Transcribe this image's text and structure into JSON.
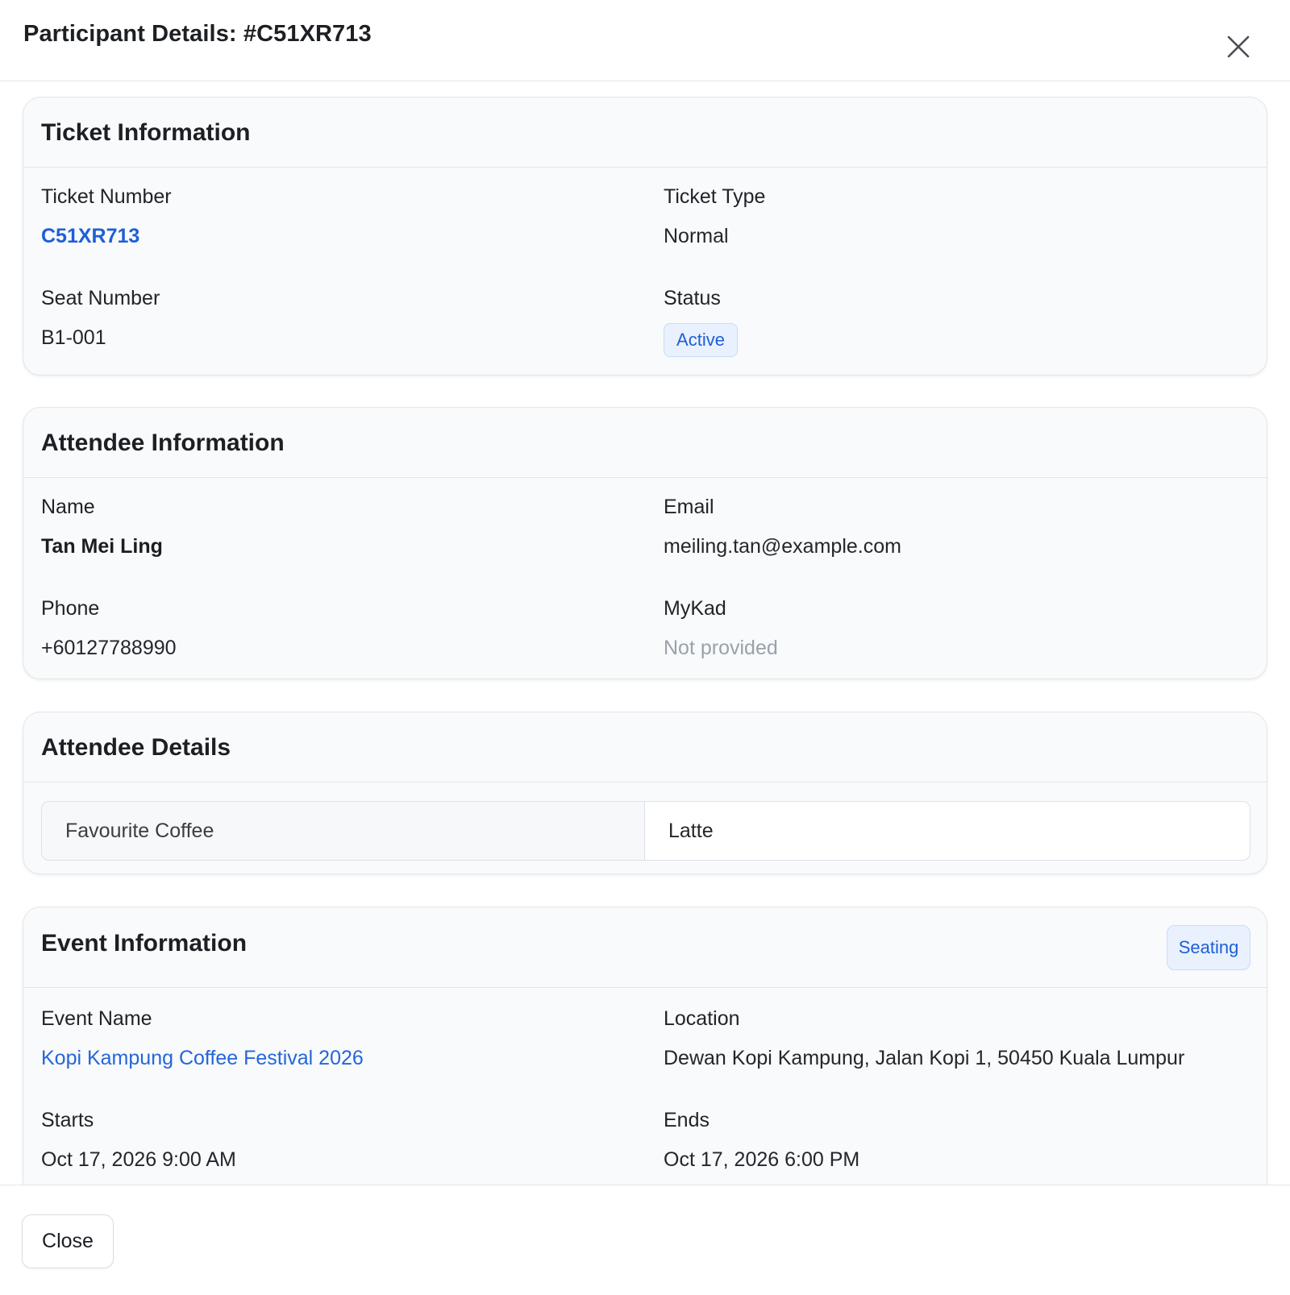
{
  "modal": {
    "title": "Participant Details: #C51XR713",
    "close_icon": "close-icon"
  },
  "ticket_info": {
    "title": "Ticket Information",
    "ticket_number_label": "Ticket Number",
    "ticket_number": "C51XR713",
    "ticket_type_label": "Ticket Type",
    "ticket_type": "Normal",
    "seat_number_label": "Seat Number",
    "seat_number": "B1-001",
    "status_label": "Status",
    "status": "Active"
  },
  "attendee_info": {
    "title": "Attendee Information",
    "name_label": "Name",
    "name": "Tan Mei Ling",
    "email_label": "Email",
    "email": "meiling.tan@example.com",
    "phone_label": "Phone",
    "phone": "+60127788990",
    "mykad_label": "MyKad",
    "mykad": "Not provided"
  },
  "attendee_details": {
    "title": "Attendee Details",
    "rows": [
      {
        "key": "Favourite Coffee",
        "value": "Latte"
      }
    ]
  },
  "event_info": {
    "title": "Event Information",
    "seating_button": "Seating",
    "event_name_label": "Event Name",
    "event_name": "Kopi Kampung Coffee Festival 2026",
    "location_label": "Location",
    "location": "Dewan Kopi Kampung, Jalan Kopi 1, 50450 Kuala Lumpur",
    "starts_label": "Starts",
    "starts": "Oct 17, 2026 9:00 AM",
    "ends_label": "Ends",
    "ends": "Oct 17, 2026 6:00 PM"
  },
  "footer": {
    "close_label": "Close"
  },
  "colors": {
    "link": "#2566d8",
    "badge_bg": "#e8f1fd",
    "card_bg": "#f8fafc",
    "border": "#e2e6ea"
  }
}
